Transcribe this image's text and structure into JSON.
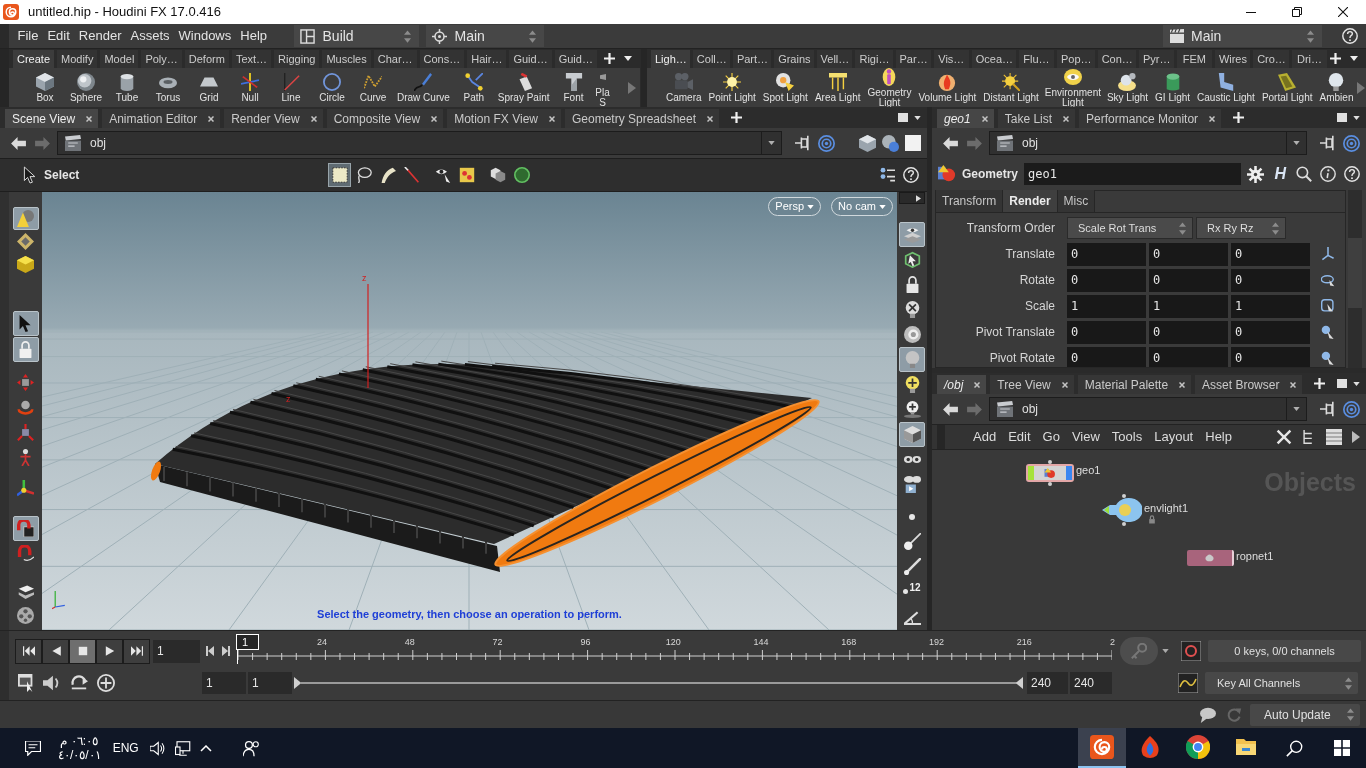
{
  "window": {
    "title": "untitled.hip - Houdini FX 17.0.416"
  },
  "menu_bar": {
    "items": [
      "File",
      "Edit",
      "Render",
      "Assets",
      "Windows",
      "Help"
    ],
    "desktop": "Build",
    "view": "Main",
    "take": "Main"
  },
  "shelves": [
    {
      "tabs": [
        {
          "label": "Create",
          "selected": true
        },
        {
          "label": "Modify",
          "selected": false
        },
        {
          "label": "Model",
          "selected": false
        },
        {
          "label": "Poly…",
          "selected": false
        },
        {
          "label": "Deform",
          "selected": false
        },
        {
          "label": "Text…",
          "selected": false
        },
        {
          "label": "Rigging",
          "selected": false
        },
        {
          "label": "Muscles",
          "selected": false
        },
        {
          "label": "Char…",
          "selected": false
        },
        {
          "label": "Cons…",
          "selected": false
        },
        {
          "label": "Hair…",
          "selected": false
        },
        {
          "label": "Guid…",
          "selected": false
        },
        {
          "label": "Guid…",
          "selected": false
        }
      ],
      "tools": [
        {
          "kind": "box",
          "label": "Box"
        },
        {
          "kind": "sphere",
          "label": "Sphere"
        },
        {
          "kind": "tube",
          "label": "Tube"
        },
        {
          "kind": "torus",
          "label": "Torus"
        },
        {
          "kind": "grid",
          "label": "Grid"
        },
        {
          "kind": "null",
          "label": "Null"
        },
        {
          "kind": "line",
          "label": "Line"
        },
        {
          "kind": "circle",
          "label": "Circle"
        },
        {
          "kind": "curve",
          "label": "Curve"
        },
        {
          "kind": "draw_curve",
          "label": "Draw Curve"
        },
        {
          "kind": "path",
          "label": "Path"
        },
        {
          "kind": "spray_paint",
          "label": "Spray Paint"
        },
        {
          "kind": "font",
          "label": "Font"
        },
        {
          "kind": "platonic",
          "label": "Pla S"
        }
      ]
    },
    {
      "tabs": [
        {
          "label": "Ligh…",
          "selected": true
        },
        {
          "label": "Coll…",
          "selected": false
        },
        {
          "label": "Part…",
          "selected": false
        },
        {
          "label": "Grains",
          "selected": false
        },
        {
          "label": "Vell…",
          "selected": false
        },
        {
          "label": "Rigi…",
          "selected": false
        },
        {
          "label": "Par…",
          "selected": false
        },
        {
          "label": "Vis…",
          "selected": false
        },
        {
          "label": "Ocea…",
          "selected": false
        },
        {
          "label": "Flu…",
          "selected": false
        },
        {
          "label": "Pop…",
          "selected": false
        },
        {
          "label": "Con…",
          "selected": false
        },
        {
          "label": "Pyr…",
          "selected": false
        },
        {
          "label": "FEM",
          "selected": false
        },
        {
          "label": "Wires",
          "selected": false
        },
        {
          "label": "Cro…",
          "selected": false
        },
        {
          "label": "Dri…",
          "selected": false
        }
      ],
      "tools": [
        {
          "kind": "camera",
          "label": "Camera"
        },
        {
          "kind": "point_light",
          "label": "Point Light"
        },
        {
          "kind": "spot_light",
          "label": "Spot Light"
        },
        {
          "kind": "area_light",
          "label": "Area Light"
        },
        {
          "kind": "geometry_light",
          "label": "Geometry Light"
        },
        {
          "kind": "volume_light",
          "label": "Volume Light"
        },
        {
          "kind": "distant_light",
          "label": "Distant Light"
        },
        {
          "kind": "environment_light",
          "label": "Environment Light"
        },
        {
          "kind": "sky_light",
          "label": "Sky Light"
        },
        {
          "kind": "gi_light",
          "label": "GI Light"
        },
        {
          "kind": "caustic_light",
          "label": "Caustic Light"
        },
        {
          "kind": "portal_light",
          "label": "Portal Light"
        },
        {
          "kind": "ambient_light",
          "label": "Ambien"
        }
      ]
    }
  ],
  "scene_pane": {
    "tabs": [
      {
        "label": "Scene View",
        "selected": true
      },
      {
        "label": "Animation Editor",
        "selected": false
      },
      {
        "label": "Render View",
        "selected": false
      },
      {
        "label": "Composite View",
        "selected": false
      },
      {
        "label": "Motion FX View",
        "selected": false
      },
      {
        "label": "Geometry Spreadsheet",
        "selected": false
      }
    ],
    "path": "obj",
    "toolbar": {
      "mode": "Select",
      "tools": [
        {
          "kind": "box",
          "selected": true
        },
        {
          "kind": "lasso",
          "selected": false
        },
        {
          "kind": "brush",
          "selected": false
        },
        {
          "kind": "laser",
          "selected": false
        },
        {
          "kind": "visible",
          "selected": false
        },
        {
          "kind": "paint",
          "selected": false
        },
        {
          "kind": "cubes",
          "selected": false
        },
        {
          "kind": "ring",
          "selected": false
        }
      ]
    },
    "left_tools": [
      {
        "kind": "shapes",
        "selected": true
      },
      {
        "kind": "diamond",
        "selected": false
      },
      {
        "kind": "cube",
        "selected": false
      },
      {
        "kind": "select",
        "selected": true
      },
      {
        "kind": "lock",
        "selected": true
      },
      {
        "kind": "move",
        "selected": false
      },
      {
        "kind": "rotate",
        "selected": false
      },
      {
        "kind": "scale",
        "selected": false
      },
      {
        "kind": "pose",
        "selected": false
      },
      {
        "kind": "handle",
        "selected": false
      },
      {
        "kind": "snap",
        "selected": true
      },
      {
        "kind": "magnet",
        "selected": false
      },
      {
        "kind": "cards",
        "selected": false
      },
      {
        "kind": "reel",
        "selected": false
      }
    ],
    "right_tools": [
      {
        "kind": "eye_layers",
        "selected": true
      },
      {
        "kind": "box_arrow",
        "selected": false
      },
      {
        "kind": "lock",
        "selected": false
      },
      {
        "kind": "bulb_cross",
        "selected": false
      },
      {
        "kind": "dial",
        "selected": false
      },
      {
        "kind": "bulb",
        "selected": true
      },
      {
        "kind": "bulb_plus",
        "selected": false
      },
      {
        "kind": "bulb_stand",
        "selected": false
      },
      {
        "kind": "shaded_cube",
        "selected": true
      },
      {
        "kind": "goggles",
        "selected": false
      },
      {
        "kind": "goggles_play",
        "selected": false
      },
      {
        "kind": "dot",
        "selected": false
      },
      {
        "kind": "needle",
        "selected": false
      },
      {
        "kind": "dropper",
        "selected": false
      },
      {
        "kind": "count",
        "label": "12",
        "selected": false
      },
      {
        "kind": "angle",
        "selected": false
      }
    ],
    "viewport": {
      "camera_menus": [
        "Persp",
        "No cam"
      ],
      "axis_labels": [
        "z",
        "z"
      ],
      "hint": "Select the geometry, then choose an operation to perform."
    }
  },
  "parameter_pane": {
    "tabs": [
      {
        "label": "geo1",
        "selected": true
      },
      {
        "label": "Take List",
        "selected": false
      },
      {
        "label": "Performance Monitor",
        "selected": false
      }
    ],
    "path": "obj",
    "node_type": "Geometry",
    "node_name": "geo1",
    "h_button": "H",
    "param_tabs": [
      {
        "label": "Transform",
        "selected": false
      },
      {
        "label": "Render",
        "selected": true
      },
      {
        "label": "Misc",
        "selected": false
      }
    ],
    "transform_order": {
      "label": "Transform Order",
      "menus": [
        "Scale Rot Trans",
        "Rx Ry Rz"
      ]
    },
    "rows": [
      {
        "label": "Translate",
        "values": [
          "0",
          "0",
          "0"
        ]
      },
      {
        "label": "Rotate",
        "values": [
          "0",
          "0",
          "0"
        ]
      },
      {
        "label": "Scale",
        "values": [
          "1",
          "1",
          "1"
        ]
      },
      {
        "label": "Pivot Translate",
        "values": [
          "0",
          "0",
          "0"
        ]
      },
      {
        "label": "Pivot Rotate",
        "values": [
          "0",
          "0",
          "0"
        ]
      }
    ]
  },
  "network_pane": {
    "tabs": [
      {
        "label": "/obj",
        "selected": true
      },
      {
        "label": "Tree View",
        "selected": false
      },
      {
        "label": "Material Palette",
        "selected": false
      },
      {
        "label": "Asset Browser",
        "selected": false
      }
    ],
    "path": "obj",
    "menu": [
      "Add",
      "Edit",
      "Go",
      "View",
      "Tools",
      "Layout",
      "Help"
    ],
    "context": "Objects",
    "nodes": [
      {
        "kind": "geometry",
        "name": "geo1",
        "locked": false
      },
      {
        "kind": "light",
        "name": "envlight1",
        "locked": true
      },
      {
        "kind": "network",
        "name": "ropnet1",
        "locked": false
      }
    ]
  },
  "timeline": {
    "transport": [
      {
        "kind": "first",
        "selected": false
      },
      {
        "kind": "back",
        "selected": false
      },
      {
        "kind": "stop",
        "selected": true
      },
      {
        "kind": "play",
        "selected": false
      },
      {
        "kind": "last",
        "selected": false
      }
    ],
    "frame": "1",
    "ticks": [
      "24",
      "48",
      "72",
      "96",
      "120",
      "144",
      "168",
      "192",
      "216",
      "2"
    ],
    "marker": "1",
    "range_start": [
      "1",
      "1"
    ],
    "range_end": [
      "240",
      "240"
    ],
    "keys": "0 keys, 0/0 channels",
    "key_mode": "Key All Channels"
  },
  "status_bar": {
    "update_mode": "Auto Update"
  },
  "taskbar": {
    "time": "٠٦:٠٥ م",
    "date": "٤٠/٠٥/٠١",
    "language": "ENG",
    "apps": [
      {
        "kind": "houdini",
        "selected": true
      },
      {
        "kind": "flame",
        "selected": false
      },
      {
        "kind": "browser",
        "selected": false
      },
      {
        "kind": "folder",
        "selected": false
      }
    ]
  }
}
